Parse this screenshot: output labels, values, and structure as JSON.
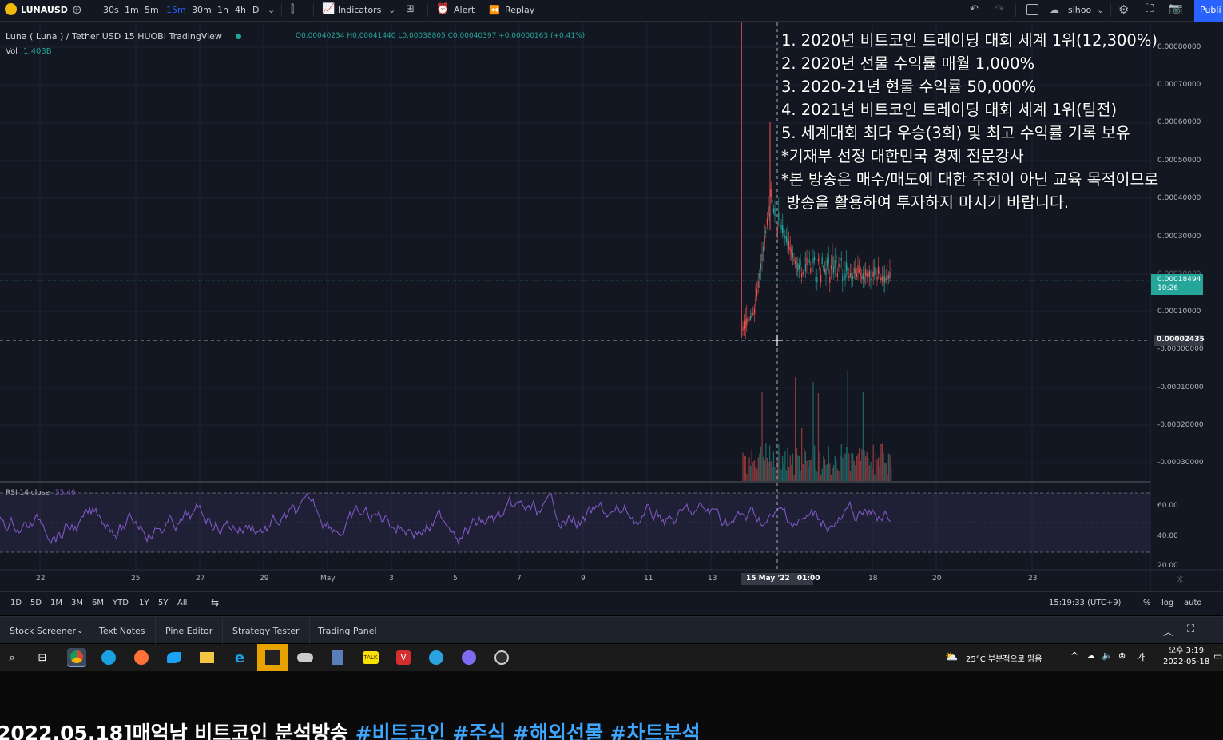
{
  "toolbar": {
    "symbol": "LUNAUSD",
    "intervals": [
      "30s",
      "1m",
      "5m",
      "15m",
      "30m",
      "1h",
      "4h",
      "D"
    ],
    "active_interval": "15m",
    "indicators_label": "Indicators",
    "alert_label": "Alert",
    "replay_label": "Replay",
    "layout_name": "sihoo",
    "publish_label": "Publi"
  },
  "legend": {
    "title": "Luna ( Luna ) / Tether USD  15  HUOBI  TradingView",
    "vol_label": "Vol",
    "vol_value": "1.403B",
    "ohlc": "O0.00040234 H0.00041440 L0.00038805 C0.00040397 +0.00000163 (+0.41%)"
  },
  "overlay_lines": [
    "1. 2020년 비트코인 트레이딩 대회 세계 1위(12,300%)",
    "2. 2020년 선물 수익률 매월 1,000%",
    "3. 2020-21년 현물 수익률 50,000%",
    "4. 2021년 비트코인 트레이딩 대회 세계 1위(팀전)",
    "5. 세계대회 최다 우승(3회) 및 최고 수익률 기록 보유",
    "*기재부 선정 대한민국 경제 전문강사",
    "*본 방송은 매수/매도에 대한 추천이 아닌 교육 목적이므로",
    " 방송을 활용하여 투자하지 마시기 바랍니다."
  ],
  "price_axis": {
    "labels": [
      "0.00080000",
      "0.00070000",
      "0.00060000",
      "0.00050000",
      "0.00040000",
      "0.00030000",
      "0.00020000",
      "0.00010000",
      "-0.00000000",
      "-0.00010000",
      "-0.00020000",
      "-0.00030000"
    ],
    "last_price": "0.00018494",
    "countdown": "10:26",
    "crosshair_price": "0.00002435",
    "price_color": "#26a69a"
  },
  "rsi": {
    "label": "RSI 14 close",
    "value": "55.46",
    "axis": [
      "60.00",
      "40.00",
      "20.00"
    ],
    "color": "#7e57c2"
  },
  "time_axis": {
    "labels": [
      "22",
      "25",
      "27",
      "29",
      "May",
      "3",
      "5",
      "7",
      "9",
      "11",
      "13",
      "18",
      "20",
      "23"
    ],
    "crosshair_date": "15 May '22",
    "crosshair_time": "01:00"
  },
  "bottombar": {
    "ranges": [
      "1D",
      "5D",
      "1M",
      "3M",
      "6M",
      "YTD",
      "1Y",
      "5Y",
      "All"
    ],
    "clock": "15:19:33 (UTC+9)",
    "percent": "%",
    "log": "log",
    "auto": "auto"
  },
  "panels": [
    "Stock Screener",
    "Text Notes",
    "Pine Editor",
    "Strategy Tester",
    "Trading Panel"
  ],
  "taskbar": {
    "weather": "25°C  부분적으로 맑음",
    "time": "오후 3:19",
    "date": "2022-05-18"
  },
  "caption": {
    "main": "2022.05.18]매억남 비트코인 분석방송 ",
    "tags": "#비트코인 #주식 #해외선물 #차트분석"
  }
}
